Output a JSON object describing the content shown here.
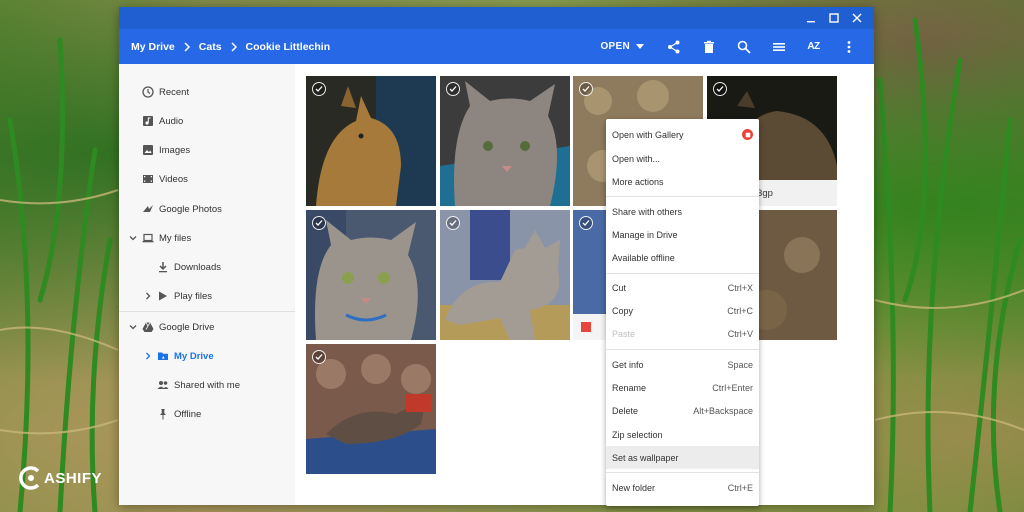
{
  "window": {
    "controls": [
      "minimize-icon",
      "maximize-icon",
      "close-icon"
    ]
  },
  "toolbar": {
    "breadcrumbs": [
      "My Drive",
      "Cats",
      "Cookie Littlechin"
    ],
    "open_label": "OPEN",
    "sort_label": "AZ",
    "icons": [
      "share-icon",
      "delete-icon",
      "search-icon",
      "list-view-icon",
      "sort-icon",
      "more-vertical-icon"
    ]
  },
  "sidebar": {
    "items": [
      {
        "label": "Recent",
        "icon": "clock-icon"
      },
      {
        "label": "Audio",
        "icon": "audio-icon"
      },
      {
        "label": "Images",
        "icon": "image-icon"
      },
      {
        "label": "Videos",
        "icon": "video-icon"
      },
      {
        "label": "Google Photos",
        "icon": "photos-icon"
      },
      {
        "label": "My files",
        "icon": "laptop-icon"
      },
      {
        "label": "Downloads",
        "icon": "download-icon"
      },
      {
        "label": "Play files",
        "icon": "play-icon"
      },
      {
        "label": "Google Drive",
        "icon": "drive-icon"
      },
      {
        "label": "My Drive",
        "icon": "folder-drive-icon"
      },
      {
        "label": "Shared with me",
        "icon": "people-icon"
      },
      {
        "label": "Offline",
        "icon": "pin-icon"
      }
    ]
  },
  "files": {
    "partial_label": "ie.3gp"
  },
  "context_menu": {
    "items": [
      {
        "label": "Open with Gallery",
        "shortcut": ""
      },
      {
        "label": "Open with...",
        "shortcut": ""
      },
      {
        "label": "More actions",
        "shortcut": ""
      },
      {
        "label": "Share with others",
        "shortcut": ""
      },
      {
        "label": "Manage in Drive",
        "shortcut": ""
      },
      {
        "label": "Available offline",
        "shortcut": ""
      },
      {
        "label": "Cut",
        "shortcut": "Ctrl+X"
      },
      {
        "label": "Copy",
        "shortcut": "Ctrl+C"
      },
      {
        "label": "Paste",
        "shortcut": "Ctrl+V"
      },
      {
        "label": "Get info",
        "shortcut": "Space"
      },
      {
        "label": "Rename",
        "shortcut": "Ctrl+Enter"
      },
      {
        "label": "Delete",
        "shortcut": "Alt+Backspace"
      },
      {
        "label": "Zip selection",
        "shortcut": ""
      },
      {
        "label": "Set as wallpaper",
        "shortcut": ""
      },
      {
        "label": "New folder",
        "shortcut": "Ctrl+E"
      }
    ],
    "highlighted": "Set as wallpaper",
    "disabled": "Paste"
  },
  "watermark": {
    "text": "ASHIFY"
  },
  "colors": {
    "titlebar": "#1f5fd1",
    "toolbar": "#2668e5",
    "active_nav": "#1a73e8",
    "gallery_badge": "#e8453c"
  }
}
